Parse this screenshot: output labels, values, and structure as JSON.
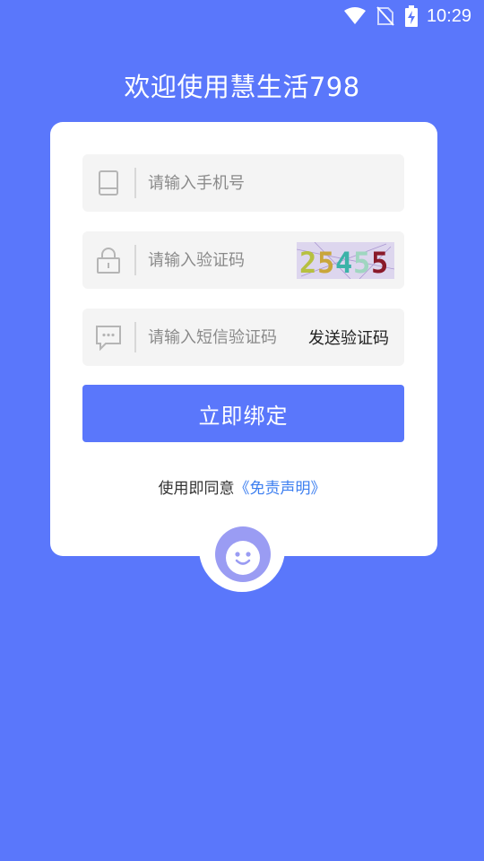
{
  "status_bar": {
    "time": "10:29",
    "icons": [
      "wifi-icon",
      "no-sim-icon",
      "battery-charging-icon"
    ]
  },
  "page": {
    "title": "欢迎使用慧生活798"
  },
  "form": {
    "phone": {
      "placeholder": "请输入手机号",
      "value": "",
      "icon": "phone-icon"
    },
    "captcha": {
      "placeholder": "请输入验证码",
      "value": "",
      "icon": "lock-icon",
      "image_text": "25455"
    },
    "sms": {
      "placeholder": "请输入短信验证码",
      "value": "",
      "icon": "message-icon",
      "send_label": "发送验证码"
    },
    "submit_label": "立即绑定"
  },
  "agreement": {
    "prefix": "使用即同意",
    "link": "《免责声明》"
  },
  "colors": {
    "background": "#5a77fb",
    "card": "#ffffff",
    "field_bg": "#f4f4f4",
    "link": "#3d7ff0",
    "avatar": "#9a9cf3"
  }
}
